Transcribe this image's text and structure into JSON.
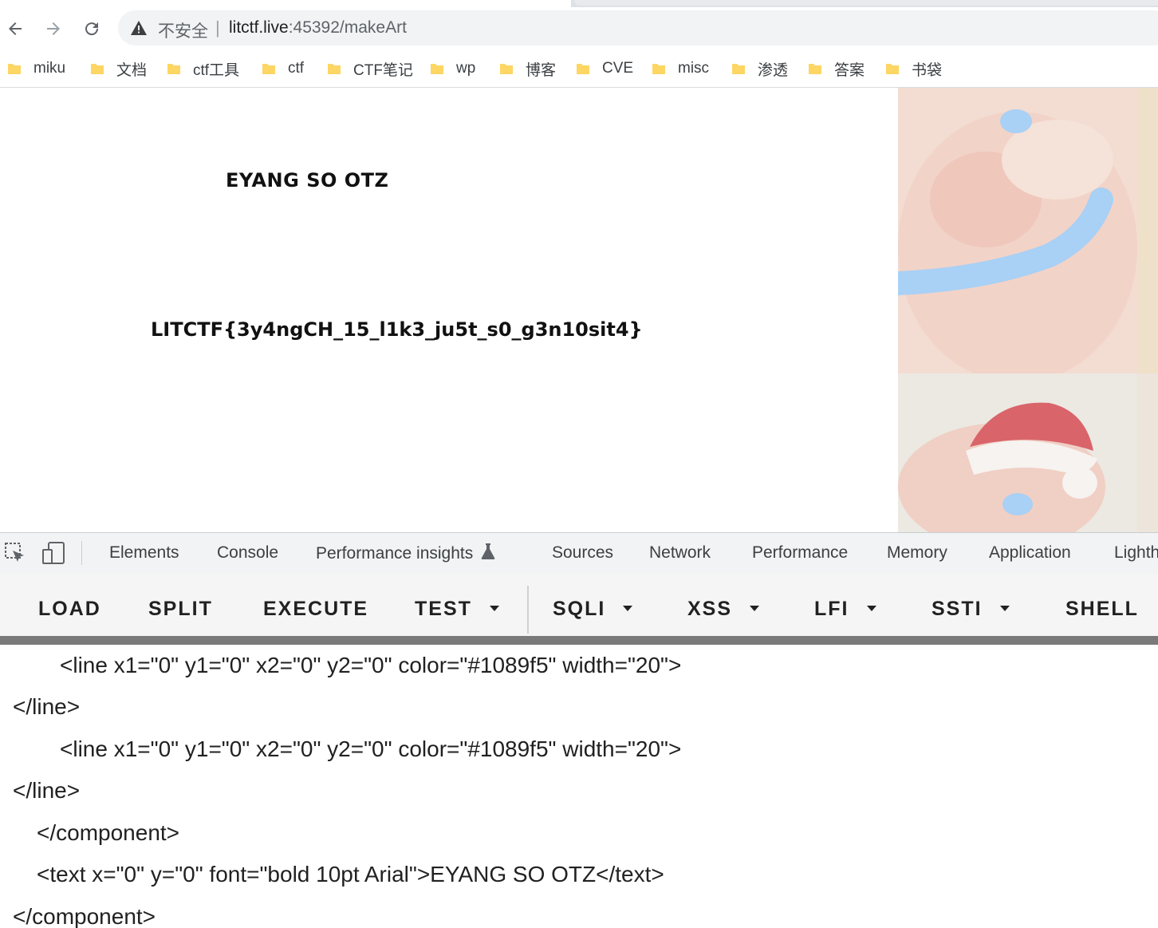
{
  "browser": {
    "security_label": "不安全",
    "separator": "|",
    "url_host": "litctf.live",
    "url_rest": ":45392/makeArt"
  },
  "bookmarks": [
    "miku",
    "文档",
    "ctf工具",
    "ctf",
    "CTF笔记",
    "wp",
    "博客",
    "CVE",
    "misc",
    "渗透",
    "答案",
    "书袋"
  ],
  "page": {
    "text_1": "EYANG SO OTZ",
    "text_2": "LITCTF{3y4ngCH_15_l1k3_ju5t_s0_g3n10sit4}"
  },
  "devtools": {
    "tabs": [
      "Elements",
      "Console",
      "Performance insights",
      "Sources",
      "Network",
      "Performance",
      "Memory",
      "Application",
      "Lighth"
    ]
  },
  "hackbar": {
    "buttons": [
      "LOAD",
      "SPLIT",
      "EXECUTE",
      "TEST",
      "SQLI",
      "XSS",
      "LFI",
      "SSTI",
      "SHELL"
    ]
  },
  "code_lines": [
    "<line x1=\"0\" y1=\"0\" x2=\"0\" y2=\"0\" color=\"#1089f5\" width=\"20\">",
    "</line>",
    "<line x1=\"0\" y1=\"0\" x2=\"0\" y2=\"0\" color=\"#1089f5\" width=\"20\">",
    "</line>",
    "</component>",
    "<text x=\"0\" y=\"0\" font=\"bold 10pt Arial\">EYANG SO OTZ</text>",
    "</component>"
  ],
  "colors": {
    "folder": "#fdd663",
    "line_blue": "#1089f5"
  }
}
